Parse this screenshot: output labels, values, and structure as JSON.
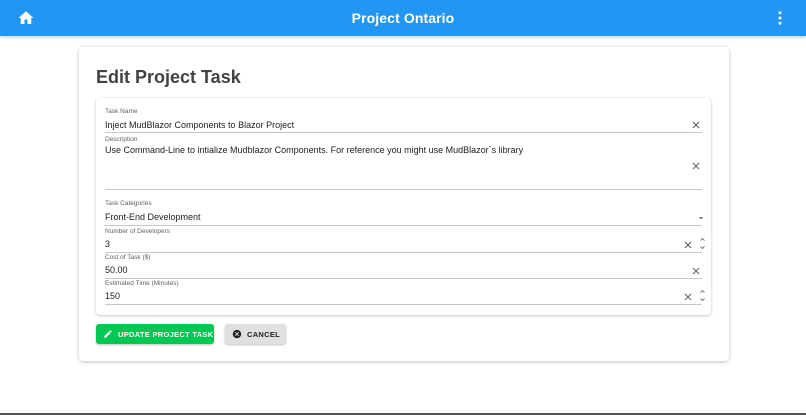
{
  "appbar": {
    "title": "Project Ontario",
    "color": "#2196f3",
    "home_icon": "home-icon",
    "menu_icon": "more-vert-icon"
  },
  "card": {
    "heading": "Edit Project Task"
  },
  "form": {
    "task_name": {
      "label": "Task Name",
      "value": "Inject MudBlazor Components to Blazor Project"
    },
    "description": {
      "label": "Description",
      "value": "Use Command-Line to intialize Mudblazor Components. For reference you might use MudBlazor`s library"
    },
    "task_categories": {
      "label": "Task Categories",
      "value": "Front-End Development"
    },
    "developers": {
      "label": "Number of Developers",
      "value": "3"
    },
    "cost": {
      "label": "Cost of Task ($)",
      "value": "50.00"
    },
    "time": {
      "label": "Estimated Time (Minutes)",
      "value": "150"
    }
  },
  "actions": {
    "update_label": "UPDATE PROJECT TASK",
    "update_color": "#00c853",
    "cancel_label": "CANCEL"
  }
}
